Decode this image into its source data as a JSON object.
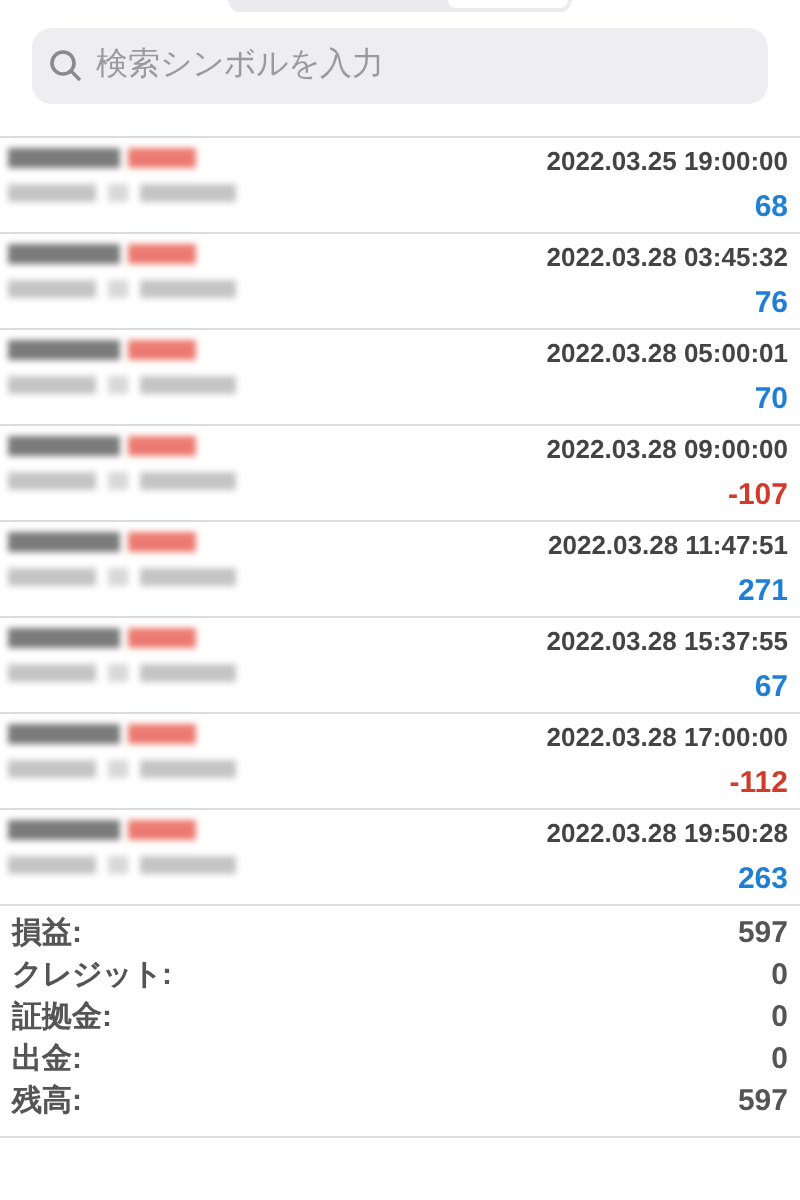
{
  "search": {
    "placeholder": "検索シンボルを入力"
  },
  "trades": [
    {
      "time": "2022.03.25 19:00:00",
      "profit": "68",
      "kind": "gain"
    },
    {
      "time": "2022.03.28 03:45:32",
      "profit": "76",
      "kind": "gain"
    },
    {
      "time": "2022.03.28 05:00:01",
      "profit": "70",
      "kind": "gain"
    },
    {
      "time": "2022.03.28 09:00:00",
      "profit": "-107",
      "kind": "loss"
    },
    {
      "time": "2022.03.28 11:47:51",
      "profit": "271",
      "kind": "gain"
    },
    {
      "time": "2022.03.28 15:37:55",
      "profit": "67",
      "kind": "gain"
    },
    {
      "time": "2022.03.28 17:00:00",
      "profit": "-112",
      "kind": "loss"
    },
    {
      "time": "2022.03.28 19:50:28",
      "profit": "263",
      "kind": "gain"
    }
  ],
  "summary": [
    {
      "label": "損益:",
      "value": "597"
    },
    {
      "label": "クレジット:",
      "value": "0"
    },
    {
      "label": "証拠金:",
      "value": "0"
    },
    {
      "label": "出金:",
      "value": "0"
    },
    {
      "label": "残高:",
      "value": "597"
    }
  ]
}
